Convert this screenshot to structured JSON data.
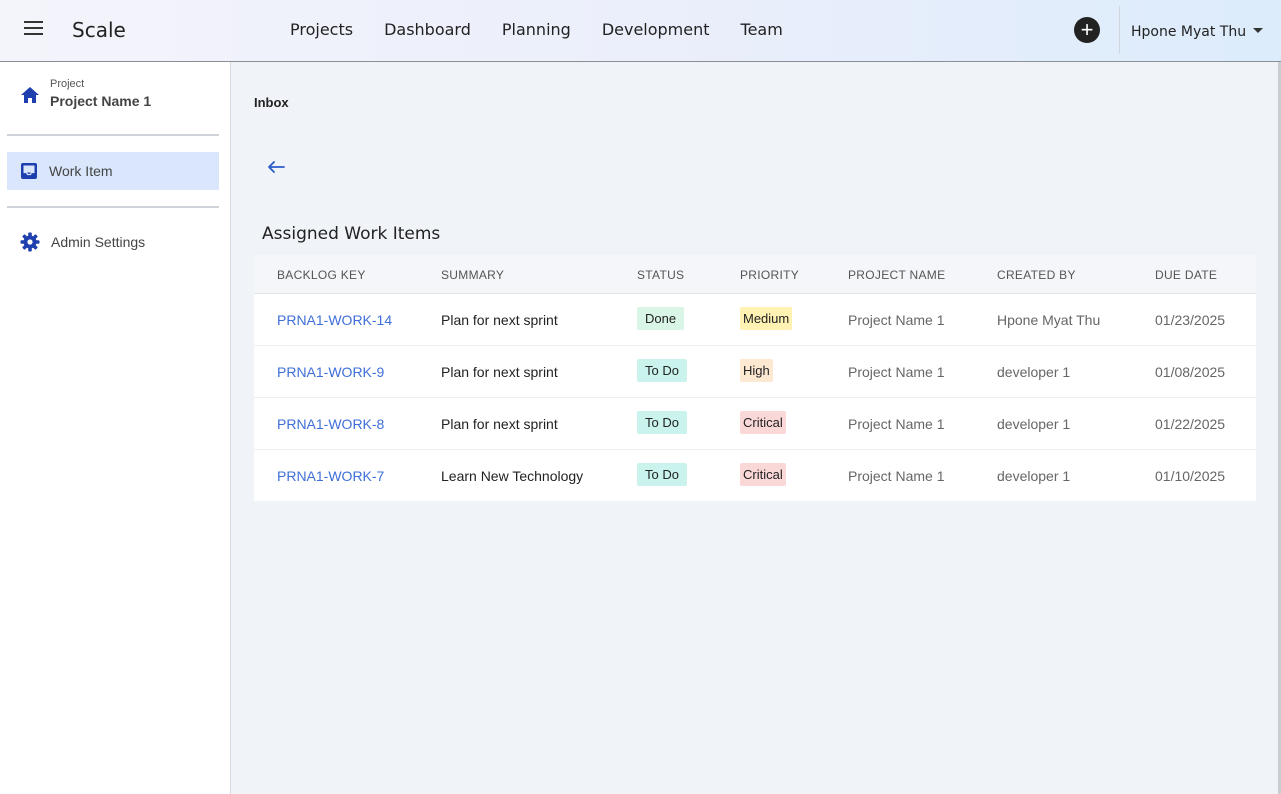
{
  "app": {
    "brand": "Scale"
  },
  "topnav": [
    "Projects",
    "Dashboard",
    "Planning",
    "Development",
    "Team"
  ],
  "user": {
    "name": "Hpone Myat Thu"
  },
  "sidebar": {
    "project_label": "Project",
    "project_name": "Project Name 1",
    "items": [
      {
        "label": "Work Item",
        "icon": "inbox-icon",
        "active": true
      },
      {
        "label": "Admin Settings",
        "icon": "gear-icon",
        "active": false
      }
    ]
  },
  "main": {
    "breadcrumb": "Inbox",
    "section_title": "Assigned Work Items",
    "table": {
      "headers": [
        "BACKLOG KEY",
        "SUMMARY",
        "STATUS",
        "PRIORITY",
        "PROJECT NAME",
        "CREATED BY",
        "DUE DATE"
      ],
      "rows": [
        {
          "key": "PRNA1-WORK-14",
          "summary": "Plan for next sprint",
          "status": "Done",
          "priority": "Medium",
          "project": "Project Name 1",
          "created_by": "Hpone Myat Thu",
          "due": "01/23/2025"
        },
        {
          "key": "PRNA1-WORK-9",
          "summary": "Plan for next sprint",
          "status": "To Do",
          "priority": "High",
          "project": "Project Name 1",
          "created_by": "developer 1",
          "due": "01/08/2025"
        },
        {
          "key": "PRNA1-WORK-8",
          "summary": "Plan for next sprint",
          "status": "To Do",
          "priority": "Critical",
          "project": "Project Name 1",
          "created_by": "developer 1",
          "due": "01/22/2025"
        },
        {
          "key": "PRNA1-WORK-7",
          "summary": "Learn New Technology",
          "status": "To Do",
          "priority": "Critical",
          "project": "Project Name 1",
          "created_by": "developer 1",
          "due": "01/10/2025"
        }
      ]
    }
  },
  "colors": {
    "accent": "#1e3fae",
    "link": "#3f6fd8",
    "active_bg": "#d9e6fb"
  }
}
